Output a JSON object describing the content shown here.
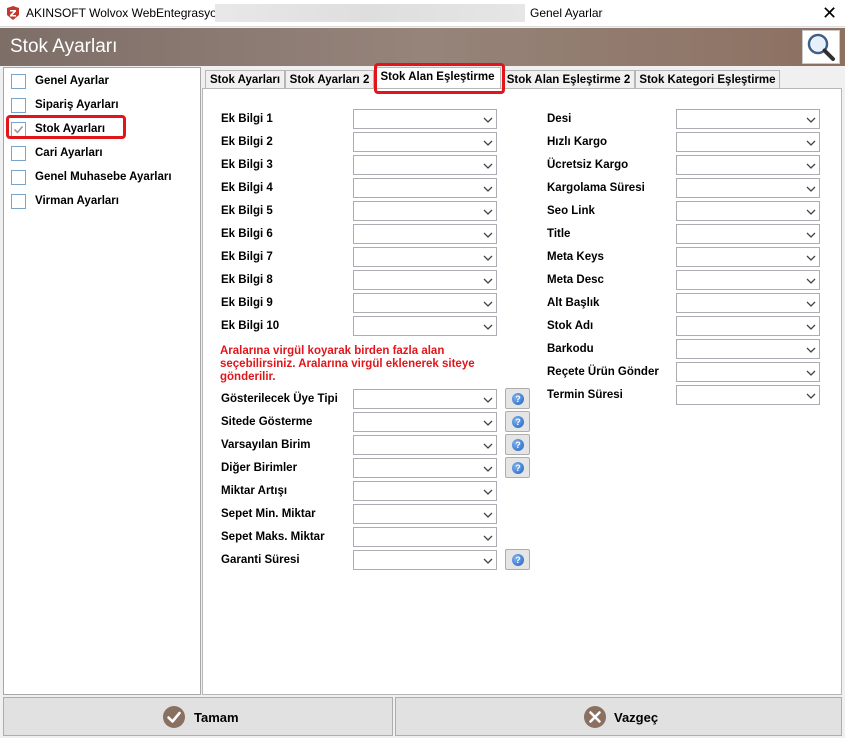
{
  "window": {
    "app_title": "AKINSOFT Wolvox WebEntegrasyon",
    "title": "Genel Ayarlar",
    "close_glyph": "✕"
  },
  "header": {
    "title": "Stok Ayarları",
    "search_icon": "search-icon"
  },
  "sidebar": {
    "items": [
      {
        "label": "Genel Ayarlar",
        "checked": false
      },
      {
        "label": "Sipariş Ayarları",
        "checked": false
      },
      {
        "label": "Stok Ayarları",
        "checked": true
      },
      {
        "label": "Cari Ayarları",
        "checked": false
      },
      {
        "label": "Genel Muhasebe Ayarları",
        "checked": false
      },
      {
        "label": "Virman Ayarları",
        "checked": false
      }
    ]
  },
  "tabs": [
    {
      "label": "Stok Ayarları"
    },
    {
      "label": "Stok Ayarları 2"
    },
    {
      "label": "Stok Alan Eşleştirme",
      "active": true
    },
    {
      "label": "Stok Alan Eşleştirme 2"
    },
    {
      "label": "Stok Kategori Eşleştirme"
    }
  ],
  "left_fields": [
    {
      "label": "Ek Bilgi 1",
      "value": ""
    },
    {
      "label": "Ek Bilgi 2",
      "value": ""
    },
    {
      "label": "Ek Bilgi 3",
      "value": ""
    },
    {
      "label": "Ek Bilgi 4",
      "value": ""
    },
    {
      "label": "Ek Bilgi 5",
      "value": ""
    },
    {
      "label": "Ek Bilgi 6",
      "value": ""
    },
    {
      "label": "Ek Bilgi 7",
      "value": ""
    },
    {
      "label": "Ek Bilgi 8",
      "value": ""
    },
    {
      "label": "Ek Bilgi 9",
      "value": ""
    },
    {
      "label": "Ek Bilgi 10",
      "value": ""
    }
  ],
  "note_text": "Aralarına virgül koyarak birden fazla alan seçebilirsiniz. Aralarına virgül  eklenerek siteye gönderilir.",
  "lower_fields": [
    {
      "label": "Gösterilecek Üye Tipi",
      "value": "",
      "help": true
    },
    {
      "label": "Sitede Gösterme",
      "value": "",
      "help": true
    },
    {
      "label": "Varsayılan Birim",
      "value": "",
      "help": true
    },
    {
      "label": "Diğer Birimler",
      "value": "",
      "help": true
    },
    {
      "label": "Miktar Artışı",
      "value": "",
      "help": false
    },
    {
      "label": "Sepet Min. Miktar",
      "value": "",
      "help": false
    },
    {
      "label": "Sepet Maks. Miktar",
      "value": "",
      "help": false
    },
    {
      "label": "Garanti Süresi",
      "value": "",
      "help": true
    }
  ],
  "right_fields": [
    {
      "label": "Desi",
      "value": ""
    },
    {
      "label": "Hızlı Kargo",
      "value": ""
    },
    {
      "label": "Ücretsiz Kargo",
      "value": ""
    },
    {
      "label": "Kargolama Süresi",
      "value": ""
    },
    {
      "label": "Seo Link",
      "value": ""
    },
    {
      "label": "Title",
      "value": ""
    },
    {
      "label": "Meta Keys",
      "value": ""
    },
    {
      "label": "Meta Desc",
      "value": ""
    },
    {
      "label": "Alt Başlık",
      "value": ""
    },
    {
      "label": "Stok Adı",
      "value": ""
    },
    {
      "label": "Barkodu",
      "value": ""
    },
    {
      "label": "Reçete Ürün Gönder",
      "value": ""
    },
    {
      "label": "Termin Süresi",
      "value": ""
    }
  ],
  "buttons": {
    "ok_label": "Tamam",
    "cancel_label": "Vazgeç"
  },
  "colors": {
    "accent": "#e0161b",
    "header": "#8a7a70",
    "note": "#e0161b"
  }
}
